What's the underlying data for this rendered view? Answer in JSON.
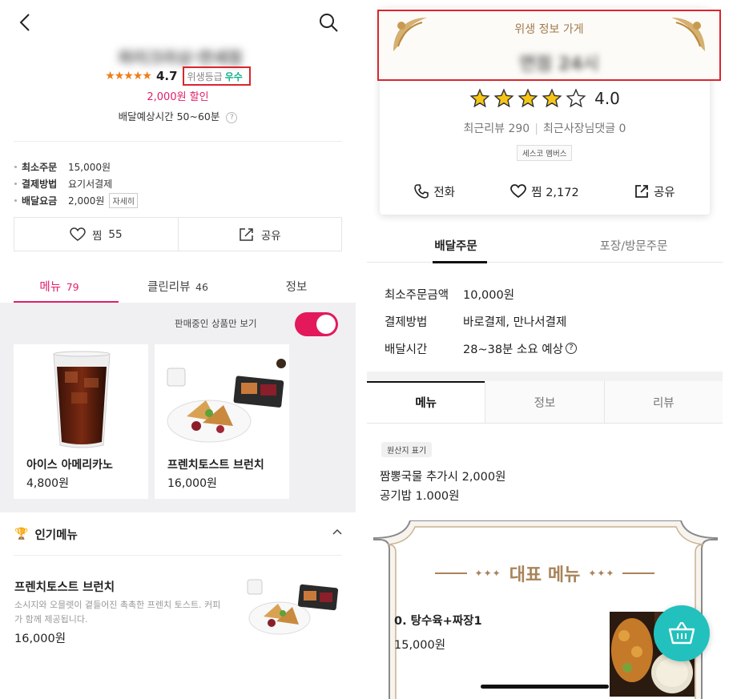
{
  "left": {
    "store_name": "파리크라상·면세점",
    "rating": "4.7",
    "hygiene_label": "위생등급",
    "hygiene_grade": "우수",
    "discount": "2,000원 할인",
    "delivery_eta": "배달예상시간 50~60분",
    "info": [
      {
        "key": "최소주문",
        "value": "15,000원"
      },
      {
        "key": "결제방법",
        "value": "요기서결제"
      },
      {
        "key": "배달요금",
        "value": "2,000원",
        "button": "자세히"
      }
    ],
    "actions": {
      "like_label": "찜",
      "like_count": "55",
      "share_label": "공유"
    },
    "tabs": [
      {
        "label": "메뉴",
        "count": "79"
      },
      {
        "label": "클린리뷰",
        "count": "46"
      },
      {
        "label": "정보",
        "count": ""
      }
    ],
    "toggle_label": "판매중인 상품만 보기",
    "cards": [
      {
        "name": "아이스 아메리카노",
        "price": "4,800원"
      },
      {
        "name": "프렌치토스트 브런치",
        "price": "16,000원"
      }
    ],
    "popular": {
      "title": "인기메뉴",
      "item_name": "프렌치토스트 브런치",
      "item_desc": "소시지와 오믈렛이 곁들어진 촉촉한 프렌치 토스트. 커피가 함께 제공됩니다.",
      "item_price": "16,000원"
    }
  },
  "right": {
    "hygiene_title": "위생 정보 가게",
    "store_name": "면점 24시",
    "rating": "4.0",
    "stars_filled": 4,
    "review_count_label": "최근리뷰 290",
    "owner_reply_label": "최근사장님댓글 0",
    "member_badge": "세스코 멤버스",
    "actions": {
      "call": "전화",
      "like": "찜 2,172",
      "share": "공유"
    },
    "order_tabs": [
      "배달주문",
      "포장/방문주문"
    ],
    "order_info": [
      {
        "key": "최소주문금액",
        "value": "10,000원"
      },
      {
        "key": "결제방법",
        "value": "바로결제, 만나서결제"
      },
      {
        "key": "배달시간",
        "value": "28~38분 소요 예상"
      }
    ],
    "menu_tabs": [
      "메뉴",
      "정보",
      "리뷰"
    ],
    "origin_badge": "원산지 표기",
    "extra_lines": [
      "짬뽕국물 추가시 2,000원",
      "공기밥  1.000원"
    ],
    "rep_title": "대표 메뉴",
    "rep_item": {
      "name": "0. 탕수육+짜장1",
      "price": "15,000원"
    }
  },
  "colors": {
    "pink": "#e0206b",
    "green": "#11b28a",
    "red_box": "#d9262e",
    "gold": "#a8835a",
    "teal": "#22c1bd",
    "star_orange": "#ee7d1b",
    "star_yellow": "#f5c518"
  }
}
